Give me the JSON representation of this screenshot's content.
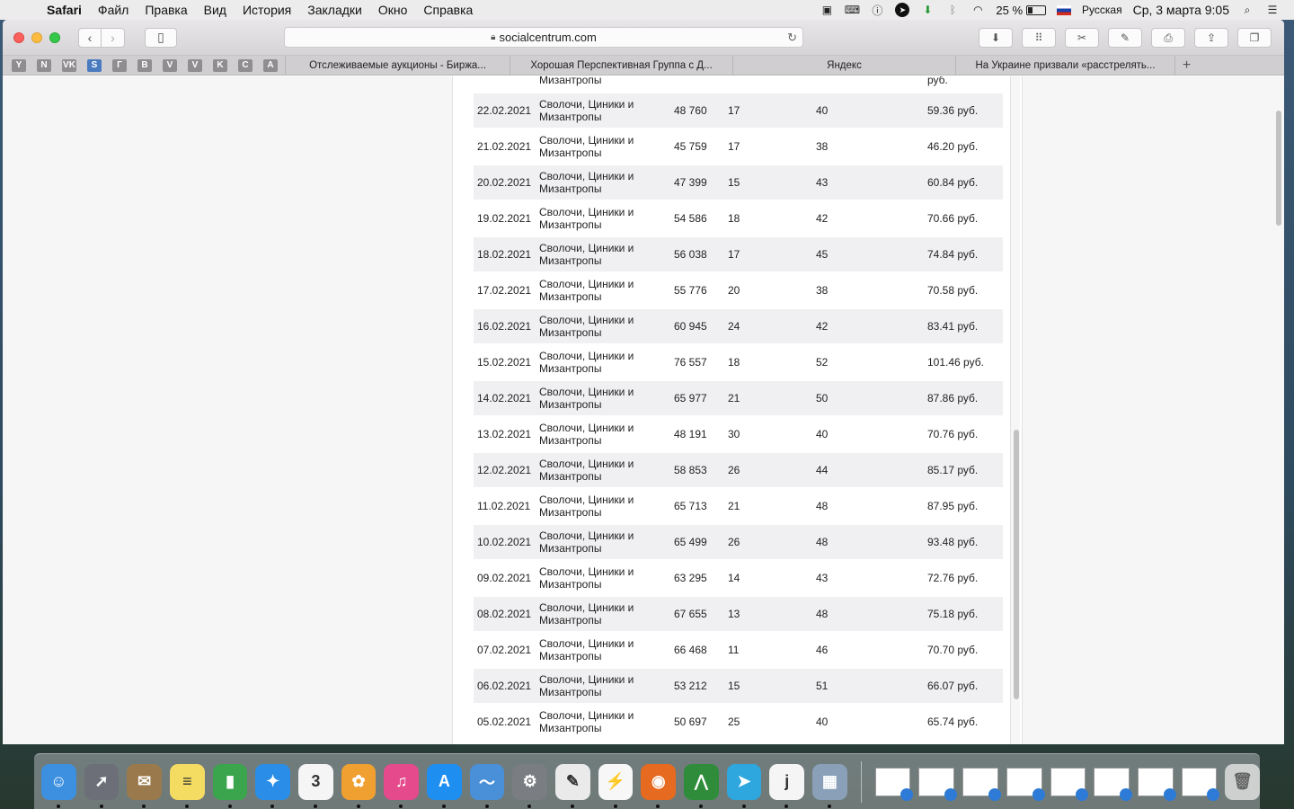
{
  "menubar": {
    "app_name": "Safari",
    "items": [
      "Файл",
      "Правка",
      "Вид",
      "История",
      "Закладки",
      "Окно",
      "Справка"
    ],
    "battery_percent": "25 %",
    "battery_level": 0.25,
    "input_language": "Русская",
    "datetime": "Ср, 3 марта  9:05"
  },
  "browser": {
    "url": "socialcentrum.com",
    "favorites": [
      "Y",
      "N",
      "VK",
      "S",
      "Г",
      "B",
      "V",
      "V",
      "K",
      "C",
      "A"
    ],
    "tabs": [
      "Отслеживаемые аукционы - Биржа...",
      "Хорошая Перспективная Группа с Д...",
      "Яндекс",
      "На Украине призвали «расстрелять..."
    ],
    "new_tab": "+"
  },
  "table": {
    "partial_top_row": {
      "name": "Мизантропы",
      "price": "руб."
    },
    "rows": [
      {
        "date": "22.02.2021",
        "name": "Сволочи, Циники и Мизантропы",
        "views": "48 760",
        "a": "17",
        "b": "40",
        "price": "59.36 руб."
      },
      {
        "date": "21.02.2021",
        "name": "Сволочи, Циники и Мизантропы",
        "views": "45 759",
        "a": "17",
        "b": "38",
        "price": "46.20 руб."
      },
      {
        "date": "20.02.2021",
        "name": "Сволочи, Циники и Мизантропы",
        "views": "47 399",
        "a": "15",
        "b": "43",
        "price": "60.84 руб."
      },
      {
        "date": "19.02.2021",
        "name": "Сволочи, Циники и Мизантропы",
        "views": "54 586",
        "a": "18",
        "b": "42",
        "price": "70.66 руб."
      },
      {
        "date": "18.02.2021",
        "name": "Сволочи, Циники и Мизантропы",
        "views": "56 038",
        "a": "17",
        "b": "45",
        "price": "74.84 руб."
      },
      {
        "date": "17.02.2021",
        "name": "Сволочи, Циники и Мизантропы",
        "views": "55 776",
        "a": "20",
        "b": "38",
        "price": "70.58 руб."
      },
      {
        "date": "16.02.2021",
        "name": "Сволочи, Циники и Мизантропы",
        "views": "60 945",
        "a": "24",
        "b": "42",
        "price": "83.41 руб."
      },
      {
        "date": "15.02.2021",
        "name": "Сволочи, Циники и Мизантропы",
        "views": "76 557",
        "a": "18",
        "b": "52",
        "price": "101.46 руб."
      },
      {
        "date": "14.02.2021",
        "name": "Сволочи, Циники и Мизантропы",
        "views": "65 977",
        "a": "21",
        "b": "50",
        "price": "87.86 руб."
      },
      {
        "date": "13.02.2021",
        "name": "Сволочи, Циники и Мизантропы",
        "views": "48 191",
        "a": "30",
        "b": "40",
        "price": "70.76 руб."
      },
      {
        "date": "12.02.2021",
        "name": "Сволочи, Циники и Мизантропы",
        "views": "58 853",
        "a": "26",
        "b": "44",
        "price": "85.17 руб."
      },
      {
        "date": "11.02.2021",
        "name": "Сволочи, Циники и Мизантропы",
        "views": "65 713",
        "a": "21",
        "b": "48",
        "price": "87.95 руб."
      },
      {
        "date": "10.02.2021",
        "name": "Сволочи, Циники и Мизантропы",
        "views": "65 499",
        "a": "26",
        "b": "48",
        "price": "93.48 руб."
      },
      {
        "date": "09.02.2021",
        "name": "Сволочи, Циники и Мизантропы",
        "views": "63 295",
        "a": "14",
        "b": "43",
        "price": "72.76 руб."
      },
      {
        "date": "08.02.2021",
        "name": "Сволочи, Циники и Мизантропы",
        "views": "67 655",
        "a": "13",
        "b": "48",
        "price": "75.18 руб."
      },
      {
        "date": "07.02.2021",
        "name": "Сволочи, Циники и Мизантропы",
        "views": "66 468",
        "a": "11",
        "b": "46",
        "price": "70.70 руб."
      },
      {
        "date": "06.02.2021",
        "name": "Сволочи, Циники и Мизантропы",
        "views": "53 212",
        "a": "15",
        "b": "51",
        "price": "66.07 руб."
      },
      {
        "date": "05.02.2021",
        "name": "Сволочи, Циники и Мизантропы",
        "views": "50 697",
        "a": "25",
        "b": "40",
        "price": "65.74 руб."
      }
    ]
  },
  "dock": {
    "apps": [
      {
        "name": "finder-icon",
        "color": "#3d8fe0",
        "glyph": "☺"
      },
      {
        "name": "launchpad-icon",
        "color": "#6c6f78",
        "glyph": "➚"
      },
      {
        "name": "mail-stamp-icon",
        "color": "#9a7a4c",
        "glyph": "✉"
      },
      {
        "name": "notes-icon",
        "color": "#f4dc62",
        "glyph": "≡"
      },
      {
        "name": "numbers-icon",
        "color": "#3aa54c",
        "glyph": "▮"
      },
      {
        "name": "safari-icon",
        "color": "#2a8ee8",
        "glyph": "✦"
      },
      {
        "name": "calendar-icon",
        "color": "#f5f5f5",
        "glyph": "3"
      },
      {
        "name": "photos-icon",
        "color": "#f0a030",
        "glyph": "✿"
      },
      {
        "name": "itunes-icon",
        "color": "#e54a8c",
        "glyph": "♫"
      },
      {
        "name": "app-store-icon",
        "color": "#1e8ef0",
        "glyph": "A"
      },
      {
        "name": "preview-icon",
        "color": "#4a90d8",
        "glyph": "〜"
      },
      {
        "name": "system-preferences-icon",
        "color": "#7a7d82",
        "glyph": "⚙"
      },
      {
        "name": "textedit-icon",
        "color": "#eaeaea",
        "glyph": "✎"
      },
      {
        "name": "activity-icon",
        "color": "#f7f7f7",
        "glyph": "⚡"
      },
      {
        "name": "firefox-icon",
        "color": "#e66a1f",
        "glyph": "◉"
      },
      {
        "name": "chart-app-icon",
        "color": "#2f8c3a",
        "glyph": "⋀"
      },
      {
        "name": "telegram-icon",
        "color": "#2ea6de",
        "glyph": "➤"
      },
      {
        "name": "joplin-icon",
        "color": "#f5f5f5",
        "glyph": "j"
      },
      {
        "name": "image-capture-icon",
        "color": "#8aa0b8",
        "glyph": "▦"
      }
    ],
    "docs_count": 8
  }
}
